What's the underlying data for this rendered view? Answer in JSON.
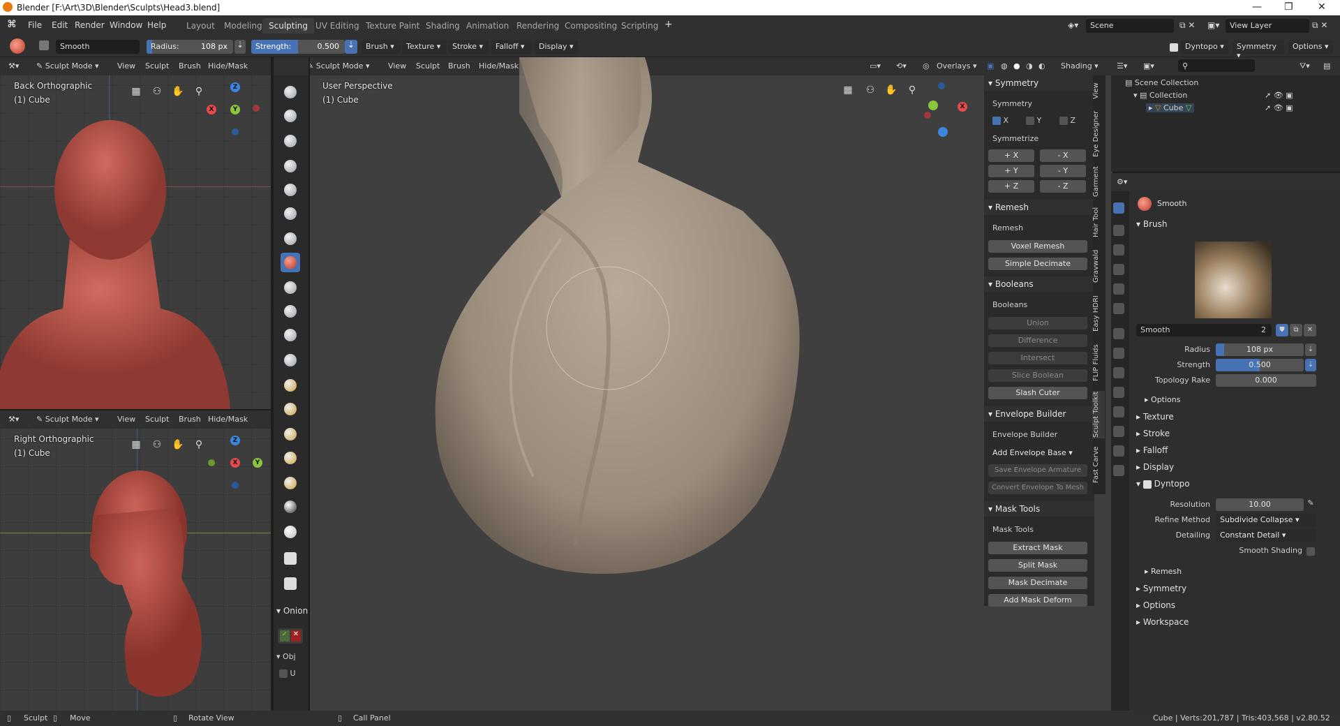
{
  "window": {
    "title": "Blender [F:\\Art\\3D\\Blender\\Sculpts\\Head3.blend]"
  },
  "menu": {
    "items": [
      "File",
      "Edit",
      "Render",
      "Window",
      "Help"
    ]
  },
  "workspaces": {
    "tabs": [
      "Layout",
      "Modeling",
      "Sculpting",
      "UV Editing",
      "Texture Paint",
      "Shading",
      "Animation",
      "Rendering",
      "Compositing",
      "Scripting"
    ],
    "active": "Sculpting",
    "add": "+"
  },
  "scene": {
    "label": "Scene",
    "view_layer": "View Layer"
  },
  "toolheader": {
    "brush_name": "Smooth",
    "radius_label": "Radius:",
    "radius_value": "108 px",
    "strength_label": "Strength:",
    "strength_value": "0.500",
    "menus": [
      "Brush",
      "Texture",
      "Stroke",
      "Falloff",
      "Display"
    ],
    "dyntopo": "Dyntopo",
    "symmetry": "Symmetry",
    "options": "Options"
  },
  "viewport_header": {
    "mode": "Sculpt Mode",
    "items": [
      "View",
      "Sculpt",
      "Brush",
      "Hide/Mask"
    ],
    "overlays": "Overlays",
    "shading": "Shading"
  },
  "viewports": {
    "back": {
      "line1": "Back Orthographic",
      "line2": "(1) Cube"
    },
    "right": {
      "line1": "Right Orthographic",
      "line2": "(1) Cube"
    },
    "main": {
      "line1": "User Perspective",
      "line2": "(1) Cube"
    }
  },
  "axes": {
    "x": "X",
    "y": "Y",
    "z": "Z"
  },
  "tool_shelf": {
    "onion_label": "Onion",
    "obj_label": "Obj",
    "u_label": "U"
  },
  "npanel": {
    "symmetry": {
      "title": "Symmetry",
      "sub": "Symmetry",
      "x": "X",
      "y": "Y",
      "z": "Z",
      "symmetrize": "Symmetrize",
      "buttons": [
        "+ X",
        "- X",
        "+ Y",
        "- Y",
        "+ Z",
        "- Z"
      ]
    },
    "remesh": {
      "title": "Remesh",
      "sub": "Remesh",
      "voxel": "Voxel Remesh",
      "decimate": "Simple Decimate"
    },
    "booleans": {
      "title": "Booleans",
      "sub": "Booleans",
      "union": "Union",
      "difference": "Difference",
      "intersect": "Intersect",
      "slice": "Slice Boolean",
      "slash": "Slash Cuter"
    },
    "envelope": {
      "title": "Envelope Builder",
      "sub": "Envelope Builder",
      "add": "Add Envelope Base",
      "save": "Save Envelope Armature",
      "convert": "Convert Envelope To Mesh"
    },
    "mask": {
      "title": "Mask Tools",
      "sub": "Mask Tools",
      "extract": "Extract Mask",
      "split": "Split Mask",
      "decimate": "Mask Decimate",
      "deform": "Add Mask Deform"
    }
  },
  "vtabs": [
    "View",
    "Eye Designer",
    "Garment",
    "Hair Tool",
    "Gravwald",
    "Easy HDRI",
    "FLIP Fluids",
    "Sculpt Toolkit",
    "Fast Carve"
  ],
  "outliner": {
    "scene_collection": "Scene Collection",
    "collection": "Collection",
    "cube": "Cube"
  },
  "properties": {
    "brush_name": "Smooth",
    "brush_section": "Brush",
    "brush_field": "Smooth",
    "brush_users": "2",
    "radius_label": "Radius",
    "radius_value": "108 px",
    "strength_label": "Strength",
    "strength_value": "0.500",
    "rake_label": "Topology Rake",
    "rake_value": "0.000",
    "options": "Options",
    "texture": "Texture",
    "stroke": "Stroke",
    "falloff": "Falloff",
    "display": "Display",
    "dyntopo": "Dyntopo",
    "resolution_label": "Resolution",
    "resolution_value": "10.00",
    "refine_label": "Refine Method",
    "refine_value": "Subdivide Collapse",
    "detailing_label": "Detailing",
    "detailing_value": "Constant Detail",
    "smooth_shading": "Smooth Shading",
    "remesh": "Remesh",
    "symmetry": "Symmetry",
    "options2": "Options",
    "workspace": "Workspace"
  },
  "status": {
    "sculpt": "Sculpt",
    "move": "Move",
    "rotate": "Rotate View",
    "call": "Call Panel",
    "stats": "Cube | Verts:201,787 | Tris:403,568 | v2.80.52"
  },
  "colors": {
    "accent": "#4772b3",
    "x_axis": "#e84a4a",
    "y_axis": "#8bc43f",
    "z_axis": "#3b87e0",
    "clay_red": "#b8514a",
    "clay_beige": "#a49686"
  }
}
